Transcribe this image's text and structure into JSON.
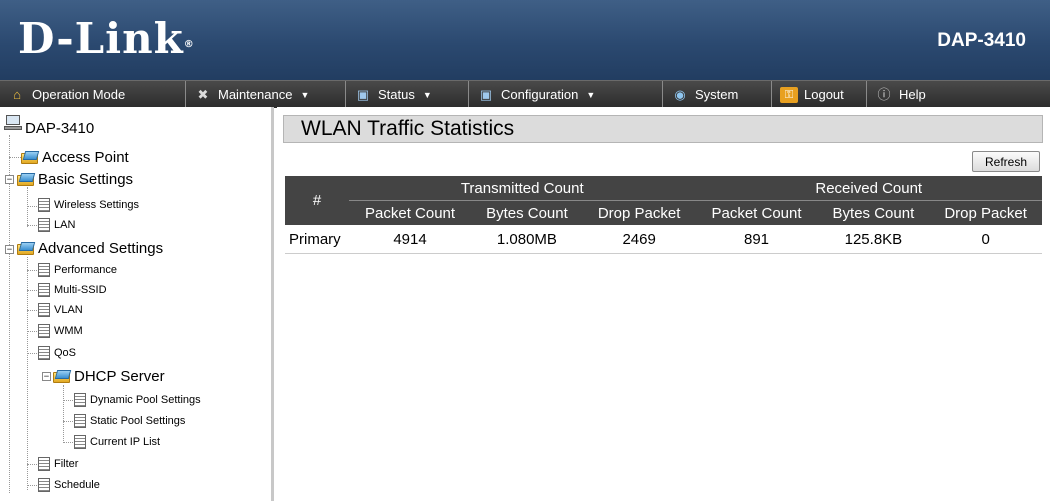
{
  "header": {
    "logo": "D-Link",
    "logo_mark": "®",
    "model": "DAP-3410"
  },
  "menu": [
    {
      "label": "Operation Mode",
      "icon": "home-icon",
      "dropdown": false
    },
    {
      "label": "Maintenance",
      "icon": "tools-icon",
      "dropdown": true
    },
    {
      "label": "Status",
      "icon": "monitor-icon",
      "dropdown": true
    },
    {
      "label": "Configuration",
      "icon": "monitor-icon",
      "dropdown": true
    },
    {
      "label": "System",
      "icon": "disk-icon",
      "dropdown": false
    },
    {
      "label": "Logout",
      "icon": "key-icon",
      "dropdown": false
    },
    {
      "label": "Help",
      "icon": "help-icon",
      "dropdown": false
    }
  ],
  "sidebar": {
    "root": "DAP-3410",
    "items": {
      "access_point": "Access Point",
      "basic_settings": "Basic Settings",
      "wireless_settings": "Wireless Settings",
      "lan": "LAN",
      "advanced_settings": "Advanced Settings",
      "performance": "Performance",
      "multi_ssid": "Multi-SSID",
      "vlan": "VLAN",
      "wmm": "WMM",
      "qos": "QoS",
      "dhcp_server": "DHCP Server",
      "dynamic_pool": "Dynamic Pool Settings",
      "static_pool": "Static Pool Settings",
      "current_ip_list": "Current IP List",
      "filter": "Filter",
      "schedule": "Schedule"
    }
  },
  "content": {
    "title": "WLAN Traffic Statistics",
    "refresh_label": "Refresh",
    "table": {
      "hash_header": "#",
      "group_headers": [
        "Transmitted Count",
        "Received Count"
      ],
      "columns": [
        "Packet Count",
        "Bytes Count",
        "Drop Packet",
        "Packet Count",
        "Bytes Count",
        "Drop Packet"
      ],
      "rows": [
        {
          "label": "Primary",
          "values": [
            "4914",
            "1.080MB",
            "2469",
            "891",
            "125.8KB",
            "0"
          ]
        }
      ]
    }
  }
}
